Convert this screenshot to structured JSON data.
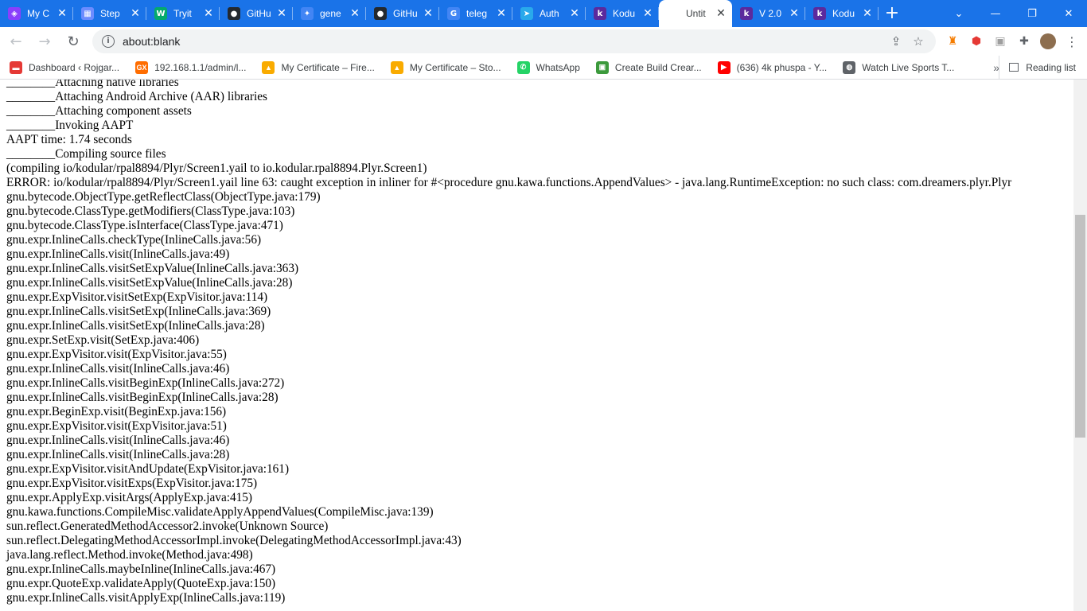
{
  "browser": {
    "tabs": [
      {
        "title": "My C",
        "favicon_color": "#8a3ffc",
        "favicon_glyph": "◈",
        "icon": "my-app-icon"
      },
      {
        "title": "Step",
        "favicon_color": "#6c8cff",
        "favicon_glyph": "▦",
        "icon": "step-icon"
      },
      {
        "title": "Tryit",
        "favicon_color": "#04aa6d",
        "favicon_glyph": "W",
        "icon": "w3schools-icon"
      },
      {
        "title": "GitHu",
        "favicon_color": "#24292f",
        "favicon_glyph": "●",
        "icon": "github-icon"
      },
      {
        "title": "gene",
        "favicon_color": "#4285f4",
        "favicon_glyph": "✦",
        "icon": "sparkle-icon"
      },
      {
        "title": "GitHu",
        "favicon_color": "#24292f",
        "favicon_glyph": "●",
        "icon": "github-icon"
      },
      {
        "title": "teleg",
        "favicon_color": "#4285f4",
        "favicon_glyph": "G",
        "icon": "google-icon"
      },
      {
        "title": "Auth",
        "favicon_color": "#29a9eb",
        "favicon_glyph": "➤",
        "icon": "telegram-icon"
      },
      {
        "title": "Kodu",
        "favicon_color": "#5b2a9d",
        "favicon_glyph": "k",
        "icon": "kodular-icon"
      },
      {
        "title": "Untit",
        "favicon_color": "#ffffff",
        "favicon_glyph": "",
        "icon": "blank-page-icon",
        "active": true
      },
      {
        "title": "V 2.0",
        "favicon_color": "#5b2a9d",
        "favicon_glyph": "k",
        "icon": "kodular-icon"
      },
      {
        "title": "Kodu",
        "favicon_color": "#5b2a9d",
        "favicon_glyph": "k",
        "icon": "kodular-icon"
      }
    ],
    "url": "about:blank",
    "bookmarks": [
      {
        "label": "Dashboard ‹ Rojgar...",
        "icon_color": "#e53935",
        "glyph": "▬"
      },
      {
        "label": "192.168.1.1/admin/l...",
        "icon_color": "#ff6d00",
        "glyph": "GX"
      },
      {
        "label": "My Certificate – Fire...",
        "icon_color": "#f9ab00",
        "glyph": "▲"
      },
      {
        "label": "My Certificate – Sto...",
        "icon_color": "#f9ab00",
        "glyph": "▲"
      },
      {
        "label": "WhatsApp",
        "icon_color": "#25d366",
        "glyph": "✆"
      },
      {
        "label": "Create Build Crear...",
        "icon_color": "#3c9a3c",
        "glyph": "▣"
      },
      {
        "label": "(636) 4k phuspa - Y...",
        "icon_color": "#ff0000",
        "glyph": "▶"
      },
      {
        "label": "Watch Live Sports T...",
        "icon_color": "#5f6368",
        "glyph": "◍"
      }
    ],
    "bookmarks_more": "»",
    "reading_list": "Reading list"
  },
  "log_lines": [
    "________Attaching native libraries",
    "________Attaching Android Archive (AAR) libraries",
    "________Attaching component assets",
    "________Invoking AAPT",
    "AAPT time: 1.74 seconds",
    "________Compiling source files",
    "(compiling io/kodular/rpal8894/Plyr/Screen1.yail to io.kodular.rpal8894.Plyr.Screen1)",
    "ERROR: io/kodular/rpal8894/Plyr/Screen1.yail line 63: caught exception in inliner for #<procedure gnu.kawa.functions.AppendValues> - java.lang.RuntimeException: no such class: com.dreamers.plyr.Plyr",
    "gnu.bytecode.ObjectType.getReflectClass(ObjectType.java:179)",
    "gnu.bytecode.ClassType.getModifiers(ClassType.java:103)",
    "gnu.bytecode.ClassType.isInterface(ClassType.java:471)",
    "gnu.expr.InlineCalls.checkType(InlineCalls.java:56)",
    "gnu.expr.InlineCalls.visit(InlineCalls.java:49)",
    "gnu.expr.InlineCalls.visitSetExpValue(InlineCalls.java:363)",
    "gnu.expr.InlineCalls.visitSetExpValue(InlineCalls.java:28)",
    "gnu.expr.ExpVisitor.visitSetExp(ExpVisitor.java:114)",
    "gnu.expr.InlineCalls.visitSetExp(InlineCalls.java:369)",
    "gnu.expr.InlineCalls.visitSetExp(InlineCalls.java:28)",
    "gnu.expr.SetExp.visit(SetExp.java:406)",
    "gnu.expr.ExpVisitor.visit(ExpVisitor.java:55)",
    "gnu.expr.InlineCalls.visit(InlineCalls.java:46)",
    "gnu.expr.InlineCalls.visitBeginExp(InlineCalls.java:272)",
    "gnu.expr.InlineCalls.visitBeginExp(InlineCalls.java:28)",
    "gnu.expr.BeginExp.visit(BeginExp.java:156)",
    "gnu.expr.ExpVisitor.visit(ExpVisitor.java:51)",
    "gnu.expr.InlineCalls.visit(InlineCalls.java:46)",
    "gnu.expr.InlineCalls.visit(InlineCalls.java:28)",
    "gnu.expr.ExpVisitor.visitAndUpdate(ExpVisitor.java:161)",
    "gnu.expr.ExpVisitor.visitExps(ExpVisitor.java:175)",
    "gnu.expr.ApplyExp.visitArgs(ApplyExp.java:415)",
    "gnu.kawa.functions.CompileMisc.validateApplyAppendValues(CompileMisc.java:139)",
    "sun.reflect.GeneratedMethodAccessor2.invoke(Unknown Source)",
    "sun.reflect.DelegatingMethodAccessorImpl.invoke(DelegatingMethodAccessorImpl.java:43)",
    "java.lang.reflect.Method.invoke(Method.java:498)",
    "gnu.expr.InlineCalls.maybeInline(InlineCalls.java:467)",
    "gnu.expr.QuoteExp.validateApply(QuoteExp.java:150)",
    "gnu.expr.InlineCalls.visitApplyExp(InlineCalls.java:119)"
  ],
  "colors": {
    "tabstrip": "#1a73e8",
    "active_tab": "#ffffff",
    "omnibox": "#f1f3f4",
    "text": "#000000"
  }
}
